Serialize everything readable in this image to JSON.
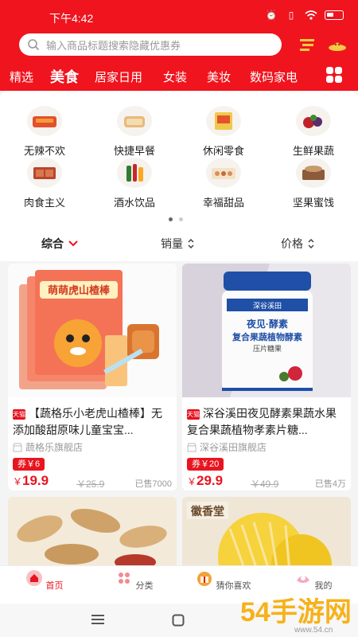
{
  "status": {
    "time": "下午4:42"
  },
  "search": {
    "placeholder": "输入商品标题搜索隐藏优惠券"
  },
  "categories": [
    "精选",
    "美食",
    "居家日用",
    "女装",
    "美妆",
    "数码家电"
  ],
  "shortcuts": [
    "无辣不欢",
    "快捷早餐",
    "休闲零食",
    "生鲜果蔬",
    "肉食主义",
    "酒水饮品",
    "幸福甜品",
    "坚果蜜饯"
  ],
  "sort": {
    "comprehensive": "综合",
    "sales": "销量",
    "price": "价格"
  },
  "products": [
    {
      "title": "【蔬格乐小老虎山楂棒】无添加酸甜原味儿童宝宝...",
      "shop": "蔬格乐旗舰店",
      "coupon": "券￥6",
      "price_symbol": "￥",
      "price": "19.9",
      "original_price": "￥25.9",
      "sold": "已售7000",
      "badge": "天猫",
      "package_text": "萌萌虎山楂棒"
    },
    {
      "title": "深谷溪田夜见酵素果蔬水果复合果蔬植物孝素片糖...",
      "shop": "深谷溪田旗舰店",
      "coupon": "券￥20",
      "price_symbol": "￥",
      "price": "29.9",
      "original_price": "￥49.9",
      "sold": "已售4万",
      "badge": "天猫",
      "package_text": "夜见·酵素",
      "package_text2": "复合果蔬植物酵素",
      "package_text3": "压片糖果",
      "package_brand": "深谷溪田"
    }
  ],
  "partial_products": [
    {
      "label": ""
    },
    {
      "label": "徽香堂"
    }
  ],
  "tabs": [
    "首页",
    "分类",
    "猜你喜欢",
    "我的"
  ],
  "watermark": {
    "text": "54手游网",
    "url": "www.54.cn"
  },
  "colors": {
    "brand": "#f0141e",
    "price": "#e8141f"
  }
}
